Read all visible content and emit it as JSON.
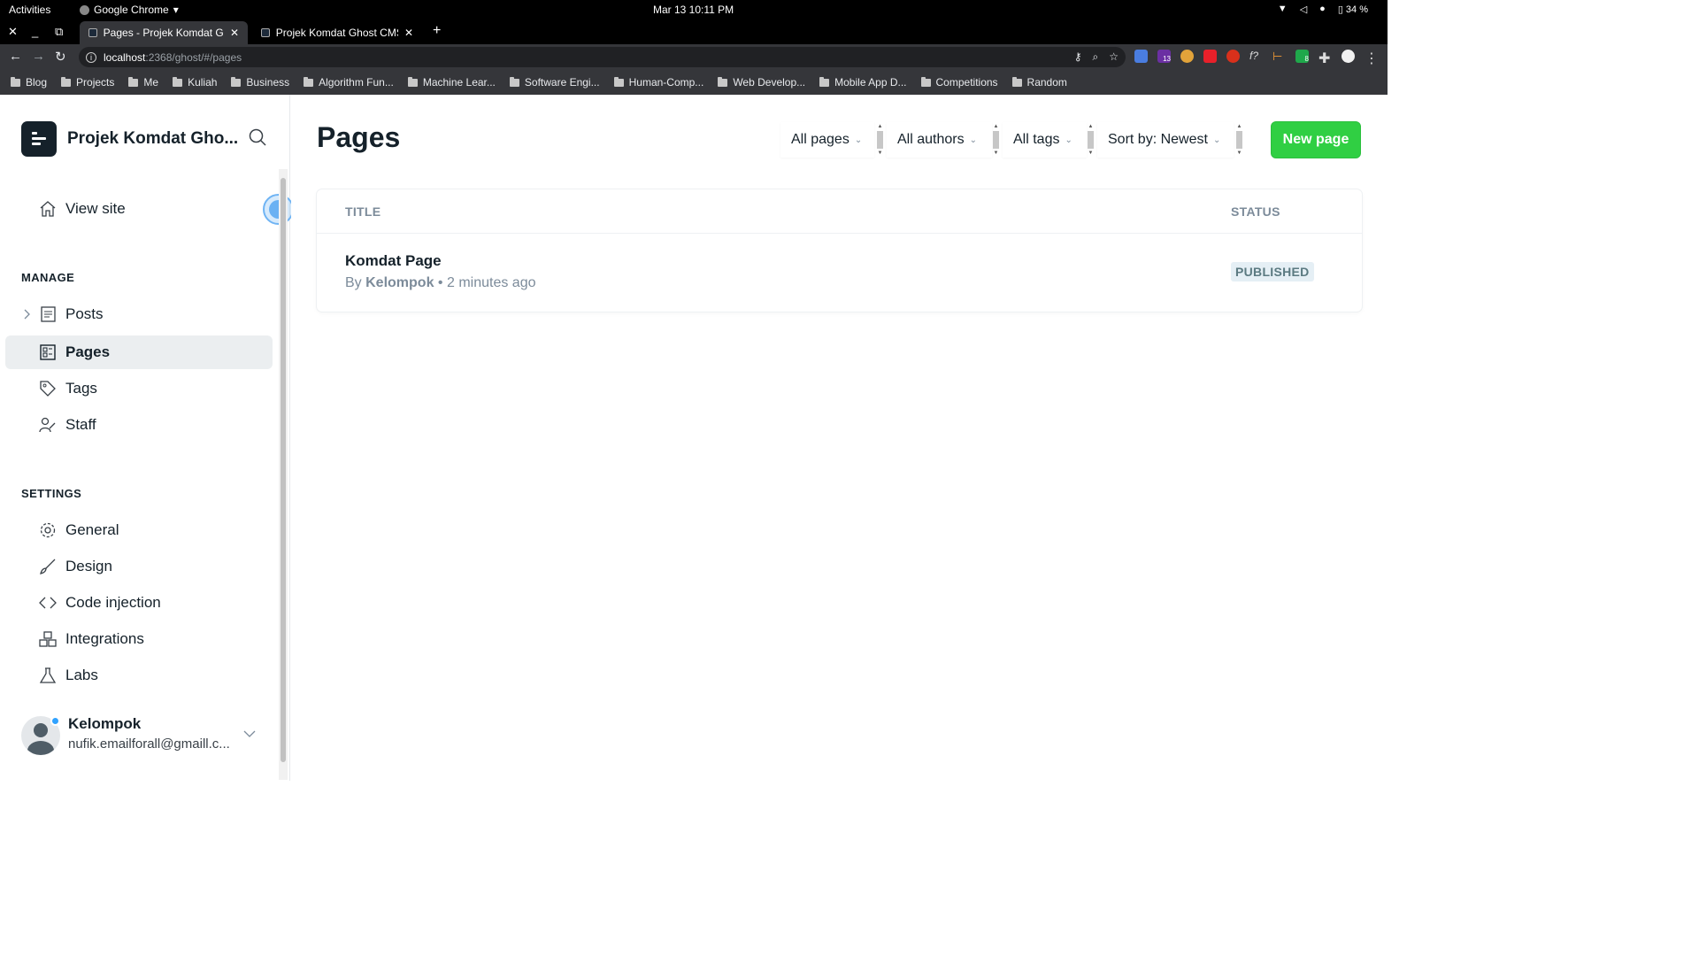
{
  "os": {
    "activities": "Activities",
    "app_name": "Google Chrome",
    "clock": "Mar 13  10:11 PM",
    "battery": "34 %"
  },
  "browser": {
    "tabs": [
      {
        "title": "Pages - Projek Komdat Gh",
        "active": true
      },
      {
        "title": "Projek Komdat Ghost CMS",
        "active": false
      }
    ],
    "url_host": "localhost",
    "url_path": ":2368/ghost/#/pages",
    "extension_badge_1": "13",
    "extension_badge_2": "8",
    "bookmarks": [
      "Blog",
      "Projects",
      "Me",
      "Kuliah",
      "Business",
      "Algorithm Fun...",
      "Machine Lear...",
      "Software Engi...",
      "Human-Comp...",
      "Web Develop...",
      "Mobile App D...",
      "Competitions",
      "Random"
    ]
  },
  "sidebar": {
    "site_name": "Projek Komdat Gho...",
    "view_site": "View site",
    "manage_heading": "MANAGE",
    "manage_items": [
      "Posts",
      "Pages",
      "Tags",
      "Staff"
    ],
    "settings_heading": "SETTINGS",
    "settings_items": [
      "General",
      "Design",
      "Code injection",
      "Integrations",
      "Labs"
    ],
    "user_name": "Kelompok",
    "user_email": "nufik.emailforall@gmaill.c..."
  },
  "main": {
    "title": "Pages",
    "filters": {
      "type": "All pages",
      "author": "All authors",
      "tag": "All tags",
      "sort": "Sort by: Newest"
    },
    "new_button": "New page",
    "columns": {
      "title": "TITLE",
      "status": "STATUS"
    },
    "rows": [
      {
        "title": "Komdat Page",
        "by": "By",
        "author": "Kelompok",
        "time": "2 minutes ago",
        "status": "PUBLISHED"
      }
    ]
  },
  "colors": {
    "accent_green": "#30cf43",
    "sidebar_active": "#ebeef0",
    "dark": "#15212a"
  }
}
